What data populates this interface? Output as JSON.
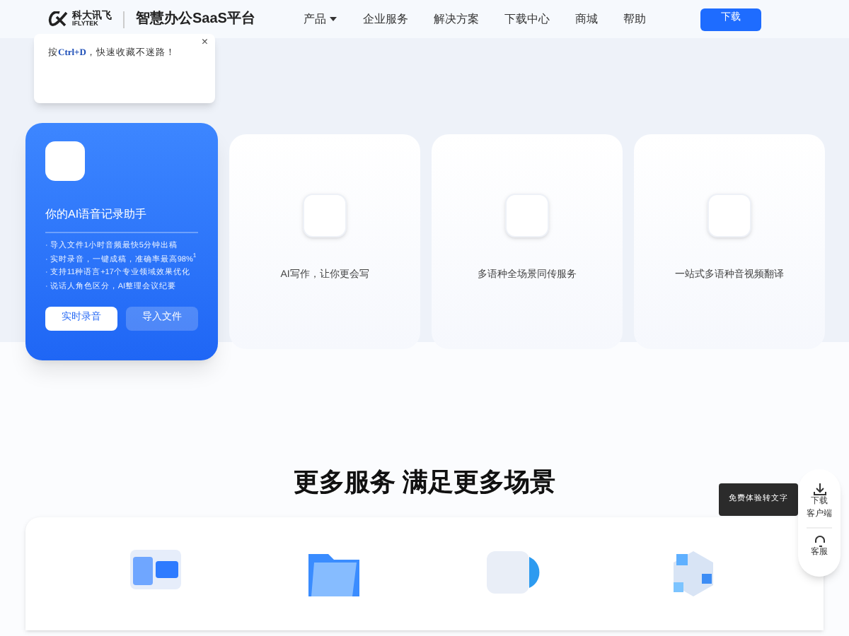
{
  "header": {
    "logo_cn": "科大讯飞",
    "logo_en": "IFLYTEK",
    "platform": "智慧办公SaaS平台",
    "nav": [
      {
        "label": "产品",
        "dropdown": true
      },
      {
        "label": "企业服务",
        "dropdown": false
      },
      {
        "label": "解决方案",
        "dropdown": false
      },
      {
        "label": "下载中心",
        "dropdown": false
      },
      {
        "label": "商城",
        "dropdown": false
      },
      {
        "label": "帮助",
        "dropdown": false
      }
    ],
    "download_button": "下载"
  },
  "bookmark_tip": {
    "prefix": "按",
    "shortcut": "Ctrl+D",
    "suffix": "，快速收藏不迷路！",
    "close": "×"
  },
  "feature_card": {
    "title": "你的AI语音记录助手",
    "bullets": [
      "· 导入文件1小时音频最快5分钟出稿",
      "· 实时录音，一键成稿，准确率最高98%$^{1}$",
      "· 支持11种语言+17个专业领域效果优化",
      "· 说话人角色区分，AI整理会议纪要"
    ],
    "buttons": [
      {
        "label": "实时录音",
        "primary": true
      },
      {
        "label": "导入文件",
        "primary": false
      }
    ]
  },
  "product_cards": [
    {
      "title": "AI写作，让你更会写"
    },
    {
      "title": "多语种全场景同传服务"
    },
    {
      "title": "一站式多语种音视频翻译"
    }
  ],
  "services": {
    "title": "更多服务 满足更多场景"
  },
  "float_tip": "免费体验转文字",
  "side_widget": [
    {
      "kind": "download",
      "lines": [
        "下载",
        "客户端"
      ]
    },
    {
      "kind": "service",
      "lines": [
        "客服"
      ]
    }
  ]
}
